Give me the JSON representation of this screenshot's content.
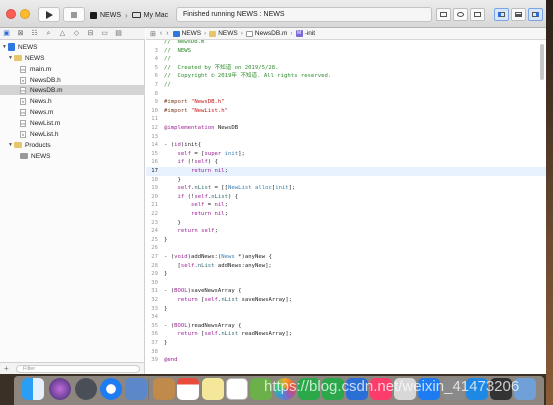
{
  "toolbar": {
    "scheme_target": "NEWS",
    "scheme_device": "My Mac",
    "status_text": "Finished running NEWS : NEWS"
  },
  "navigator": {
    "items": [
      {
        "label": "NEWS"
      },
      {
        "label": "NEWS"
      },
      {
        "label": "main.m"
      },
      {
        "label": "NewsDB.h"
      },
      {
        "label": "NewsDB.m"
      },
      {
        "label": "News.h"
      },
      {
        "label": "News.m"
      },
      {
        "label": "NewList.m"
      },
      {
        "label": "NewList.h"
      },
      {
        "label": "Products"
      },
      {
        "label": "NEWS"
      }
    ],
    "filter_placeholder": "Filter"
  },
  "jumpbar": {
    "crumbs": [
      "NEWS",
      "NEWS",
      "NewsDB.m",
      "-init"
    ]
  },
  "editor": {
    "current_line": 17,
    "lines": [
      {
        "n": "",
        "t": "//  NewsDB.m"
      },
      {
        "n": "3",
        "t": "//  NEWS"
      },
      {
        "n": "4",
        "t": "//"
      },
      {
        "n": "5",
        "t": "//  Created by 不知道 on 2019/5/28."
      },
      {
        "n": "6",
        "t": "//  Copyright © 2019年 不知道. All rights reserved."
      },
      {
        "n": "7",
        "t": "//"
      },
      {
        "n": "8",
        "t": ""
      },
      {
        "n": "9",
        "t": "#import \"NewsDB.h\""
      },
      {
        "n": "10",
        "t": "#import \"NewList.h\""
      },
      {
        "n": "11",
        "t": ""
      },
      {
        "n": "12",
        "t": "@implementation NewsDB"
      },
      {
        "n": "13",
        "t": ""
      },
      {
        "n": "14",
        "t": "- (id)init{"
      },
      {
        "n": "15",
        "t": "    self = [super init];"
      },
      {
        "n": "16",
        "t": "    if (!self) {"
      },
      {
        "n": "17",
        "t": "        return nil;"
      },
      {
        "n": "18",
        "t": "    }"
      },
      {
        "n": "19",
        "t": "    self.nList = [[NewList alloc]init];"
      },
      {
        "n": "20",
        "t": "    if (!self.nList) {"
      },
      {
        "n": "21",
        "t": "        self = nil;"
      },
      {
        "n": "22",
        "t": "        return nil;"
      },
      {
        "n": "23",
        "t": "    }"
      },
      {
        "n": "24",
        "t": "    return self;"
      },
      {
        "n": "25",
        "t": "}"
      },
      {
        "n": "26",
        "t": ""
      },
      {
        "n": "27",
        "t": "- (void)addNews:(News *)anyNew {"
      },
      {
        "n": "28",
        "t": "    [self.nList addNews:anyNew];"
      },
      {
        "n": "29",
        "t": "}"
      },
      {
        "n": "30",
        "t": ""
      },
      {
        "n": "31",
        "t": "- (BOOL)saveNewsArray {"
      },
      {
        "n": "32",
        "t": "    return [self.nList saveNewsArray];"
      },
      {
        "n": "33",
        "t": "}"
      },
      {
        "n": "34",
        "t": ""
      },
      {
        "n": "35",
        "t": "- (BOOL)readNewsArray {"
      },
      {
        "n": "36",
        "t": "    return [self.nList readNewsArray];"
      },
      {
        "n": "37",
        "t": "}"
      },
      {
        "n": "38",
        "t": ""
      },
      {
        "n": "39",
        "t": "@end"
      }
    ]
  },
  "watermark": "https://blog.csdn.net/weixin_41473206"
}
